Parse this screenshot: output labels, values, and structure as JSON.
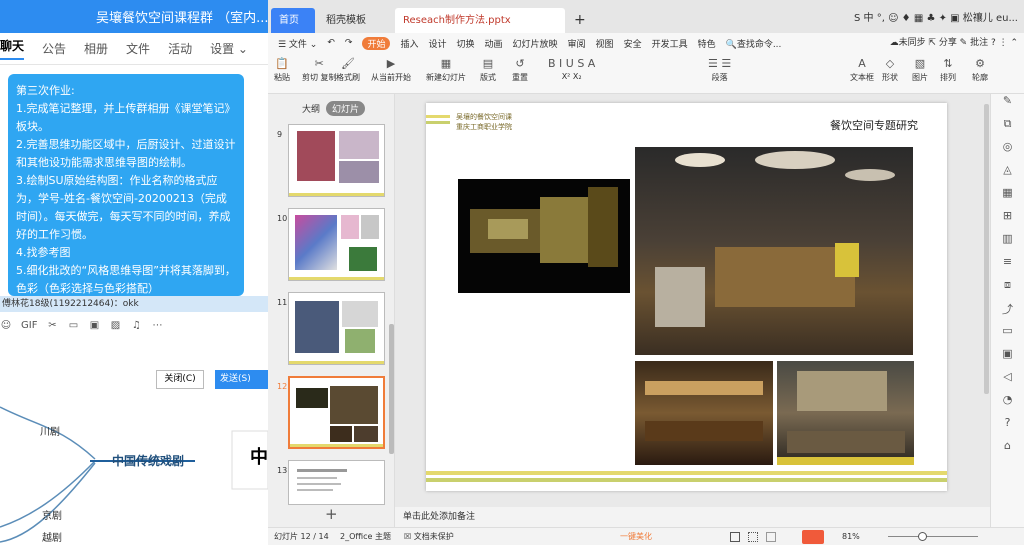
{
  "qq": {
    "title": "吴壤餐饮空间课程群  （室内...",
    "tabs": [
      "聊天",
      "公告",
      "相册",
      "文件",
      "活动",
      "设置 ⌄"
    ],
    "message_lines": [
      "第三次作业:",
      "1.完成笔记整理，并上传群相册《课堂笔记》板块。",
      "2.完善思维功能区域中，后厨设计、过道设计和其他设功能需求思维导图的绘制。",
      "3.绘制SU原始结构图：作业名称的格式应为，学号-姓名-餐饮空间-20200213（完成时间）。每天做完，每天写不同的时间，养成好的工作习惯。",
      "4.找参考图",
      "5.细化批改的“风格思维导图”并将其落脚到，色彩（色彩选择与色彩搭配）"
    ],
    "sender_line": "傅林花18级(1192212464)：okk",
    "toolbar_icons": [
      "☺",
      "GIF",
      "✂",
      "▭",
      "▣",
      "▨",
      "♫",
      "⋯"
    ],
    "close_label": "关闭(C)",
    "send_label": "发送(S)"
  },
  "mindmap": {
    "center": "中国传统戏剧",
    "nodes": [
      "川剧",
      "京剧",
      "越剧"
    ],
    "partial": "中"
  },
  "wps": {
    "tabs": {
      "home": "首页",
      "template": "稻壳模板",
      "doc": "Reseach制作方法.pptx",
      "add": "+"
    },
    "tab_right": "S 中 °, ☺ ♦ ▦ ♣ ✦ ▣    松禳儿 eu...",
    "menu": [
      "☰ 文件 ⌄",
      "↶",
      "↷",
      "开始",
      "插入",
      "设计",
      "切换",
      "动画",
      "幻灯片放映",
      "审阅",
      "视图",
      "安全",
      "开发工具",
      "特色",
      "🔍查找命令..."
    ],
    "menu_right": "☁未同步  ⇱ 分享  ✎ 批注  ?  ⋮  ⌃",
    "ribbon": [
      {
        "icon": "📋",
        "label": "粘贴"
      },
      {
        "icon": "✂",
        "label": "剪切 复制"
      },
      {
        "icon": "🖌",
        "label": "格式刷"
      },
      {
        "icon": "▶",
        "label": "从当前开始"
      },
      {
        "icon": "▦",
        "label": "新建幻灯片"
      },
      {
        "icon": "▤",
        "label": "版式"
      },
      {
        "icon": "↺",
        "label": "重置"
      },
      {
        "icon": "B I U S A",
        "label": "X² X₂"
      },
      {
        "icon": "☰ ☰",
        "label": "段落"
      },
      {
        "icon": "A",
        "label": "文本框"
      },
      {
        "icon": "◇",
        "label": "形状"
      },
      {
        "icon": "▧",
        "label": "图片"
      },
      {
        "icon": "⇅",
        "label": "排列"
      },
      {
        "icon": "⚙",
        "label": "轮廓"
      }
    ],
    "panel_tabs": [
      "大纲",
      "幻灯片"
    ],
    "thumbs": [
      "9",
      "10",
      "11",
      "12",
      "13"
    ],
    "add_slide": "+",
    "slide": {
      "header_line1": "吴壤的餐饮空间课",
      "header_line2": "重庆工商职业学院",
      "title": "餐饮空间专题研究"
    },
    "notes": "单击此处添加备注",
    "rightbar_icons": [
      "✎",
      "⧉",
      "◎",
      "◬",
      "▦",
      "⊞",
      "▥",
      "≡",
      "⧈",
      "⤴",
      "▭",
      "▣",
      "◁",
      "◔",
      "?",
      "⌂"
    ],
    "status": {
      "slide_count": "幻灯片 12 / 14",
      "theme": "2_Office 主题",
      "protect": "☒ 文档未保护",
      "beautify": "一键美化",
      "zoom": "81%"
    }
  }
}
